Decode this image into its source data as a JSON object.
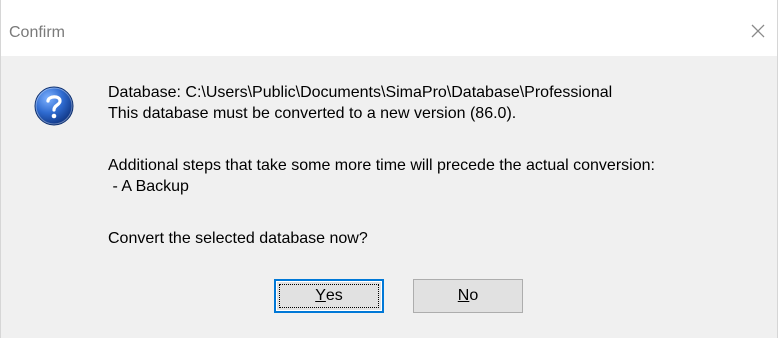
{
  "window": {
    "title": "Confirm",
    "close_icon": "close-icon"
  },
  "message": {
    "line1": "Database: C:\\Users\\Public\\Documents\\SimaPro\\Database\\Professional",
    "line2": "This database must be converted to a new version (86.0).",
    "line3": "Additional steps that take some more time will precede the actual conversion:",
    "line4": " - A Backup",
    "line5": "Convert the selected database now?",
    "icon": "question-icon"
  },
  "buttons": {
    "yes_prefix": "Y",
    "yes_rest": "es",
    "no_prefix": "N",
    "no_rest": "o"
  },
  "colors": {
    "accent": "#0078d7",
    "icon_blue": "#1f5fb8"
  }
}
